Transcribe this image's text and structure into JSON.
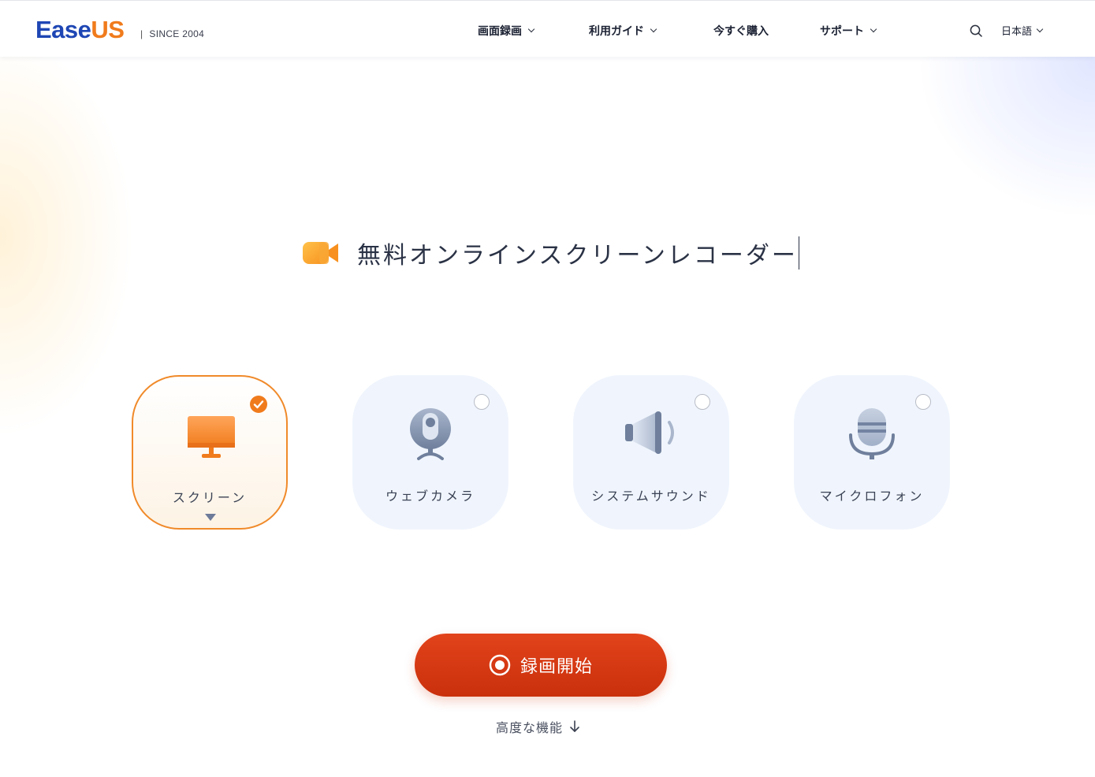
{
  "header": {
    "logo_part1": "Ease",
    "logo_part2": "US",
    "since": "SINCE 2004",
    "nav": [
      {
        "label": "画面録画",
        "has_dropdown": true
      },
      {
        "label": "利用ガイド",
        "has_dropdown": true
      },
      {
        "label": "今すぐ購入",
        "has_dropdown": false
      },
      {
        "label": "サポート",
        "has_dropdown": true
      }
    ],
    "search_icon": "search-icon",
    "language": "日本語"
  },
  "hero": {
    "title": "無料オンラインスクリーンレコーダー",
    "title_icon": "video-camera-icon"
  },
  "sources": [
    {
      "label": "スクリーン",
      "icon": "monitor-icon",
      "selected": true
    },
    {
      "label": "ウェブカメラ",
      "icon": "webcam-icon",
      "selected": false
    },
    {
      "label": "システムサウンド",
      "icon": "speaker-icon",
      "selected": false
    },
    {
      "label": "マイクロフォン",
      "icon": "microphone-icon",
      "selected": false
    }
  ],
  "record_button": {
    "label": "録画開始",
    "icon": "record-icon"
  },
  "advanced": {
    "label": "高度な機能",
    "icon": "arrow-down-icon"
  },
  "colors": {
    "brand_blue": "#1e46b4",
    "brand_orange": "#f07b1c",
    "record_red": "#d8380f",
    "card_bg": "#f0f5fd",
    "selected_border": "#f08a2a"
  }
}
